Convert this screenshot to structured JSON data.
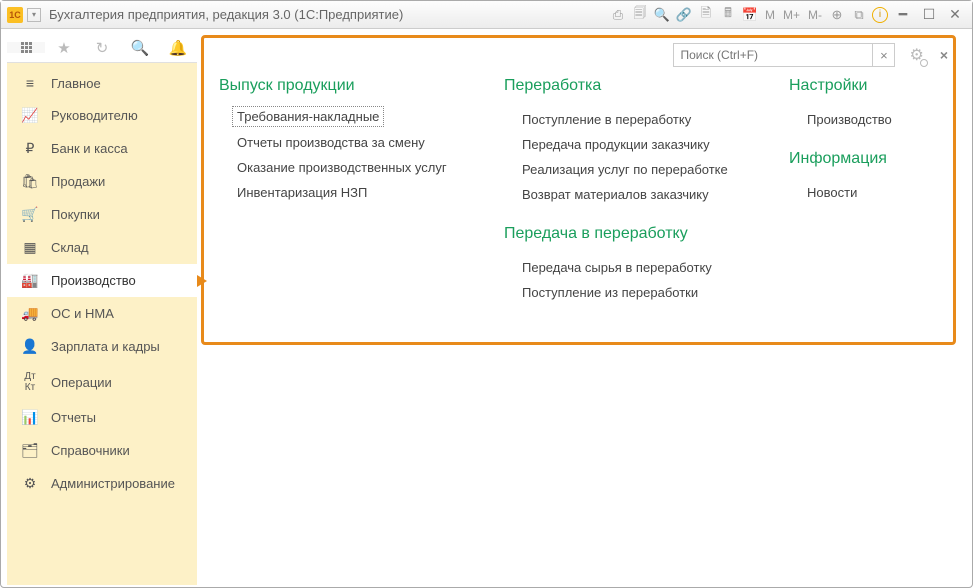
{
  "titlebar": {
    "logo_text": "1C",
    "title": "Бухгалтерия предприятия, редакция 3.0  (1С:Предприятие)",
    "mem_buttons": [
      "M",
      "M+",
      "M-"
    ]
  },
  "sidebar": {
    "items": [
      {
        "icon": "≡",
        "label": "Главное"
      },
      {
        "icon": "✓",
        "label": "Руководителю"
      },
      {
        "icon": "₽",
        "label": "Банк и касса"
      },
      {
        "icon": "🛍",
        "label": "Продажи"
      },
      {
        "icon": "🛒",
        "label": "Покупки"
      },
      {
        "icon": "▦",
        "label": "Склад"
      },
      {
        "icon": "🏭",
        "label": "Производство",
        "active": true
      },
      {
        "icon": "🚚",
        "label": "ОС и НМА"
      },
      {
        "icon": "👤",
        "label": "Зарплата и кадры"
      },
      {
        "icon": "ᴬᵏ",
        "label": "Операции"
      },
      {
        "icon": "🗠",
        "label": "Отчеты"
      },
      {
        "icon": "📚",
        "label": "Справочники"
      },
      {
        "icon": "⚙",
        "label": "Администрирование"
      }
    ]
  },
  "search": {
    "placeholder": "Поиск (Ctrl+F)"
  },
  "content": {
    "col1": {
      "title": "Выпуск продукции",
      "links": [
        "Требования-накладные",
        "Отчеты производства за смену",
        "Оказание производственных услуг",
        "Инвентаризация НЗП"
      ]
    },
    "col2a": {
      "title": "Переработка",
      "links": [
        "Поступление в переработку",
        "Передача продукции заказчику",
        "Реализация услуг по переработке",
        "Возврат материалов заказчику"
      ]
    },
    "col2b": {
      "title": "Передача в переработку",
      "links": [
        "Передача сырья в переработку",
        "Поступление из переработки"
      ]
    },
    "col3a": {
      "title": "Настройки",
      "links": [
        "Производство"
      ]
    },
    "col3b": {
      "title": "Информация",
      "links": [
        "Новости"
      ]
    }
  }
}
